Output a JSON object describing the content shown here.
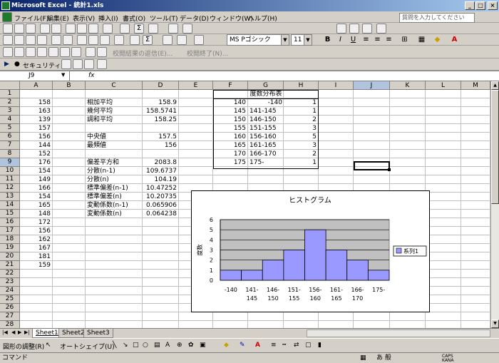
{
  "window": {
    "title": "Microsoft Excel - 統計1.xls"
  },
  "menu": [
    "ファイル(F)",
    "編集(E)",
    "表示(V)",
    "挿入(I)",
    "書式(O)",
    "ツール(T)",
    "データ(D)",
    "ウィンドウ(W)",
    "ヘルプ(H)"
  ],
  "help_placeholder": "質問を入力してください",
  "toolbar": {
    "font_name": "MS Pゴシック",
    "font_size": "11",
    "review_reply": "校閲結果の返信(E)...",
    "review_end": "校閲終了(N)...",
    "security": "セキュリティ..."
  },
  "formula": {
    "cell_ref": "J9",
    "fx": "fx",
    "value": ""
  },
  "columns": [
    "A",
    "B",
    "C",
    "D",
    "E",
    "F",
    "G",
    "H",
    "I",
    "J",
    "K",
    "L",
    "M"
  ],
  "selected_column": "J",
  "rows": [
    "1",
    "2",
    "3",
    "4",
    "5",
    "6",
    "7",
    "8",
    "9",
    "10",
    "11",
    "12",
    "13",
    "14",
    "15",
    "16",
    "17",
    "18",
    "19",
    "20",
    "21",
    "22",
    "23",
    "24",
    "25",
    "26",
    "27",
    "28"
  ],
  "selected_row": "9",
  "colA": [
    "158",
    "163",
    "139",
    "157",
    "156",
    "144",
    "152",
    "176",
    "154",
    "149",
    "166",
    "154",
    "165",
    "148",
    "172",
    "156",
    "162",
    "167",
    "181",
    "159"
  ],
  "stats_labels": [
    "相加平均",
    "幾何平均",
    "調和平均",
    "",
    "中央値",
    "最頻値",
    "",
    "偏差平方和",
    "分散(n-1)",
    "分散(n)",
    "標準偏差(n-1)",
    "標準偏差(n)",
    "変動係数(n-1)",
    "変動係数(n)"
  ],
  "stats_values": [
    "158.9",
    "158.5741",
    "158.25",
    "",
    "157.5",
    "156",
    "",
    "2083.8",
    "109.6737",
    "104.19",
    "10.47252",
    "10.20735",
    "0.065906",
    "0.064238"
  ],
  "freq_table": {
    "title": "度数分布表",
    "rows": [
      {
        "f": "140",
        "g": "-140",
        "h": "1",
        "g_align": "right"
      },
      {
        "f": "145",
        "g": "141-145",
        "h": "1",
        "g_align": "left"
      },
      {
        "f": "150",
        "g": "146-150",
        "h": "2",
        "g_align": "left"
      },
      {
        "f": "155",
        "g": "151-155",
        "h": "3",
        "g_align": "left"
      },
      {
        "f": "160",
        "g": "156-160",
        "h": "5",
        "g_align": "left"
      },
      {
        "f": "165",
        "g": "161-165",
        "h": "3",
        "g_align": "left"
      },
      {
        "f": "170",
        "g": "166-170",
        "h": "2",
        "g_align": "left"
      },
      {
        "f": "175",
        "g": "175-",
        "h": "1",
        "g_align": "left"
      }
    ]
  },
  "chart_data": {
    "type": "bar",
    "title": "ヒストグラム",
    "ylabel": "度数",
    "xlabel": "",
    "categories": [
      [
        "-140",
        ""
      ],
      [
        "141-",
        "145"
      ],
      [
        "146-",
        "150"
      ],
      [
        "151-",
        "155"
      ],
      [
        "156-",
        "160"
      ],
      [
        "161-",
        "165"
      ],
      [
        "166-",
        "170"
      ],
      [
        "175-",
        ""
      ]
    ],
    "series": [
      {
        "name": "系列1",
        "values": [
          1,
          1,
          2,
          3,
          5,
          3,
          2,
          1
        ]
      }
    ],
    "ylim": [
      0,
      6
    ],
    "yticks": [
      "0",
      "1",
      "2",
      "3",
      "4",
      "5",
      "6"
    ],
    "grid": true,
    "legend": "right",
    "colors": {
      "bar": "#9999ff",
      "plot_bg": "#c0c0c0"
    }
  },
  "sheets": [
    "Sheet1",
    "Sheet2",
    "Sheet3"
  ],
  "active_sheet": "Sheet1",
  "drawbar": {
    "draw_label": "図形の調整(R)",
    "autoshape_label": "オートシェイプ(U)"
  },
  "status": {
    "text": "コマンド",
    "ime": "あ 般",
    "caps": "CAPS KANA"
  }
}
